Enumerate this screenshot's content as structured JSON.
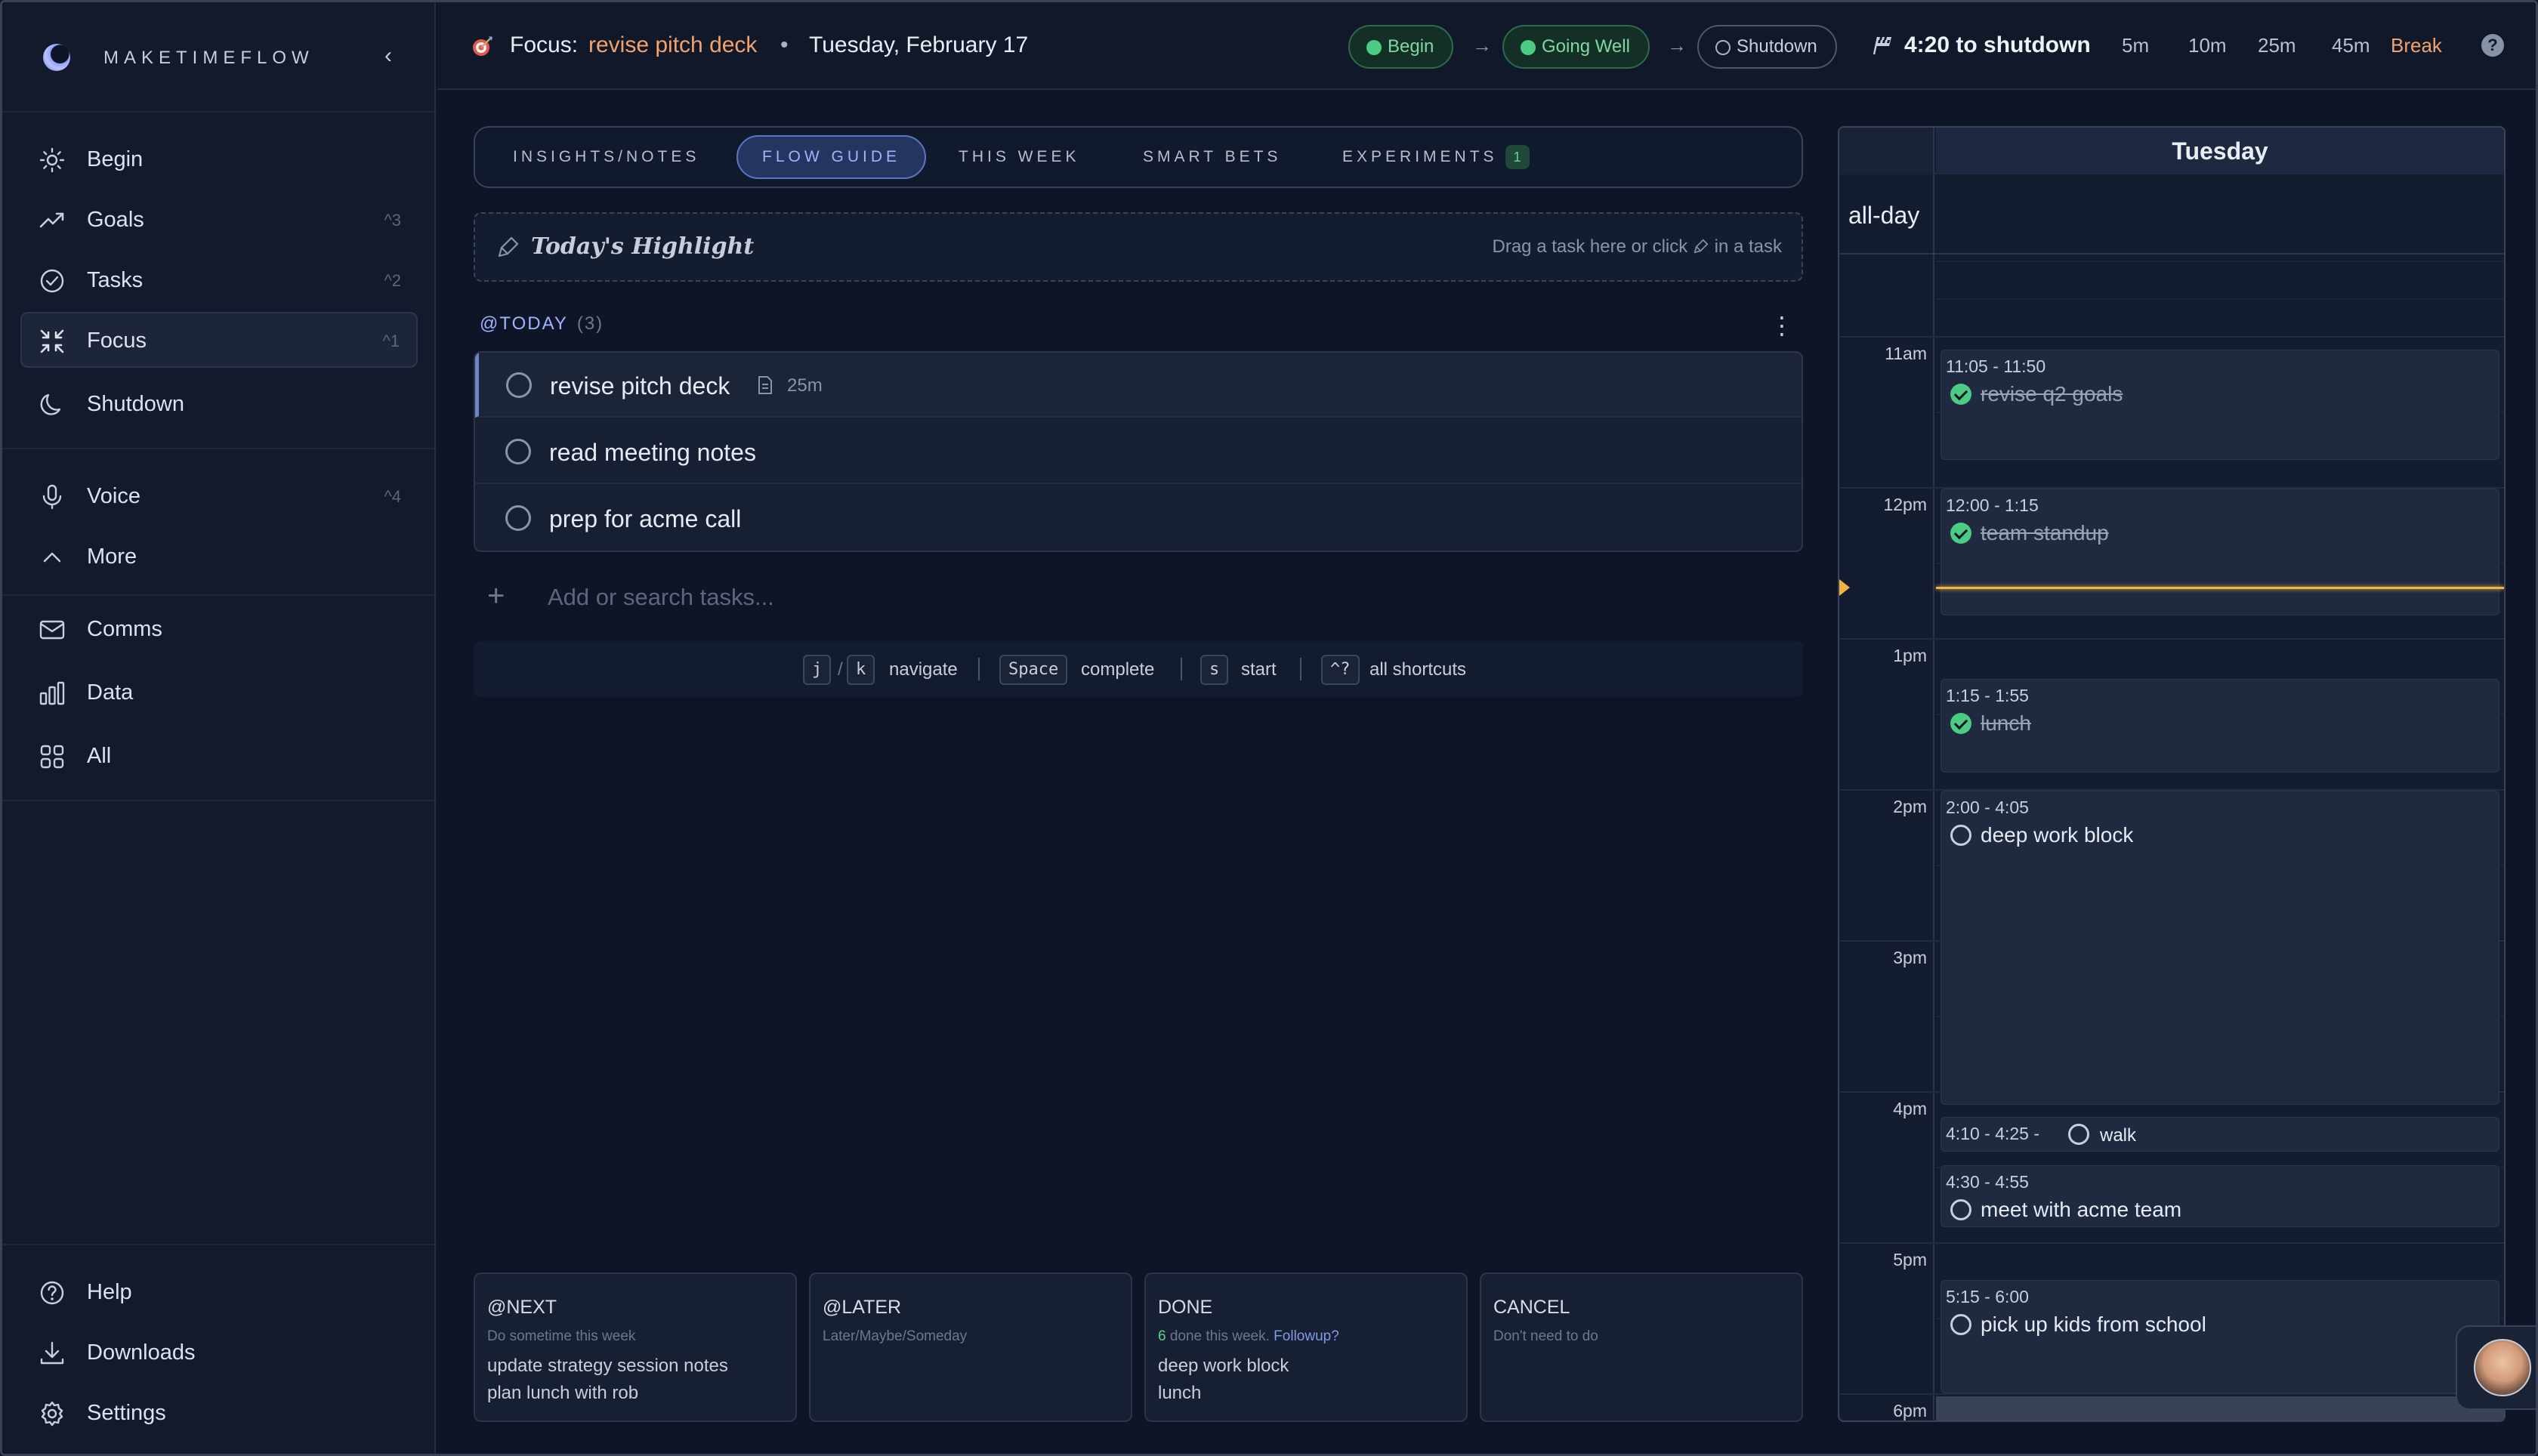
{
  "app": {
    "brand": "MAKETIMEFLOW",
    "collapse_glyph": "‹"
  },
  "sidebar": {
    "items": [
      {
        "label": "Begin",
        "shortcut": "",
        "icon": "sun-icon"
      },
      {
        "label": "Goals",
        "shortcut": "^3",
        "icon": "trend-up-icon"
      },
      {
        "label": "Tasks",
        "shortcut": "^2",
        "icon": "check-circle-icon"
      },
      {
        "label": "Focus",
        "shortcut": "^1",
        "icon": "focus-arrows-icon",
        "active": true
      },
      {
        "label": "Shutdown",
        "shortcut": "",
        "icon": "moon-icon"
      },
      {
        "label": "Voice",
        "shortcut": "^4",
        "icon": "microphone-icon"
      },
      {
        "label": "More",
        "shortcut": "",
        "icon": "chevron-up-icon"
      },
      {
        "label": "Comms",
        "shortcut": "",
        "icon": "mail-icon"
      },
      {
        "label": "Data",
        "shortcut": "",
        "icon": "bar-chart-icon"
      },
      {
        "label": "All",
        "shortcut": "",
        "icon": "grid-icon"
      }
    ],
    "footer": [
      {
        "label": "Help",
        "icon": "help-circle-icon"
      },
      {
        "label": "Downloads",
        "icon": "download-icon"
      },
      {
        "label": "Settings",
        "icon": "gear-icon"
      }
    ]
  },
  "topbar": {
    "focus_label": "Focus:",
    "focus_task": "revise pitch deck",
    "separator": "•",
    "date": "Tuesday, February 17",
    "stages": [
      {
        "label": "Begin",
        "state": "done"
      },
      {
        "label": "Going Well",
        "state": "done"
      },
      {
        "label": "Shutdown",
        "state": "pending"
      }
    ],
    "arrow": "→",
    "shutdown_timer": "4:20 to shutdown",
    "timers": [
      "5m",
      "10m",
      "25m",
      "45m"
    ],
    "break_label": "Break",
    "help_glyph": "?"
  },
  "tabs": [
    {
      "label": "INSIGHTS/NOTES"
    },
    {
      "label": "FLOW GUIDE",
      "active": true
    },
    {
      "label": "THIS WEEK"
    },
    {
      "label": "SMART BETS"
    },
    {
      "label": "EXPERIMENTS",
      "badge": "1"
    }
  ],
  "highlight": {
    "title": "Today's Highlight",
    "hint_prefix": "Drag a task here or click",
    "hint_suffix": "in a task"
  },
  "today": {
    "heading": "@TODAY",
    "count": "(3)",
    "tasks": [
      {
        "text": "revise pitch deck",
        "duration": "25m",
        "has_note": true
      },
      {
        "text": "read meeting notes"
      },
      {
        "text": "prep for acme call"
      }
    ],
    "add_placeholder": "Add or search tasks...",
    "add_glyph": "+"
  },
  "shortcuts": {
    "j": "j",
    "slash": "/",
    "k": "k",
    "navigate": "navigate",
    "space": "Space",
    "complete": "complete",
    "s": "s",
    "start": "start",
    "help": "^?",
    "all": "all shortcuts"
  },
  "buckets": [
    {
      "title": "@NEXT",
      "subtitle": "Do sometime this week",
      "items": [
        "update strategy session notes",
        "plan lunch with rob"
      ]
    },
    {
      "title": "@LATER",
      "subtitle": "Later/Maybe/Someday",
      "items": []
    },
    {
      "title": "DONE",
      "subtitle_count": "6",
      "subtitle_text": " done this week.",
      "subtitle_link": "Followup?",
      "items": [
        "deep work block",
        "lunch"
      ]
    },
    {
      "title": "CANCEL",
      "subtitle": "Don't need to do",
      "items": []
    }
  ],
  "calendar": {
    "day": "Tuesday",
    "allday_label": "all-day",
    "hours": [
      "11am",
      "12pm",
      "1pm",
      "2pm",
      "3pm",
      "4pm",
      "5pm",
      "6pm"
    ],
    "events": [
      {
        "time": "11:05 - 11:50",
        "title": "revise q2 goals",
        "done": true
      },
      {
        "time": "12:00 - 1:15",
        "title": "team standup",
        "done": true
      },
      {
        "time": "1:15 - 1:55",
        "title": "lunch",
        "done": true
      },
      {
        "time": "2:00 - 4:05",
        "title": "deep work block",
        "done": false
      },
      {
        "time": "4:10 - 4:25 -",
        "title": "walk",
        "done": false
      },
      {
        "time": "4:30 - 4:55",
        "title": "meet with acme team",
        "done": false
      },
      {
        "time": "5:15 - 6:00",
        "title": "pick up kids from school",
        "done": false
      }
    ]
  },
  "colors": {
    "accent": "#9db5ff",
    "orange": "#f2a26b",
    "green": "#4ccb83",
    "now_line": "#f2b441",
    "background": "#0e1527"
  }
}
